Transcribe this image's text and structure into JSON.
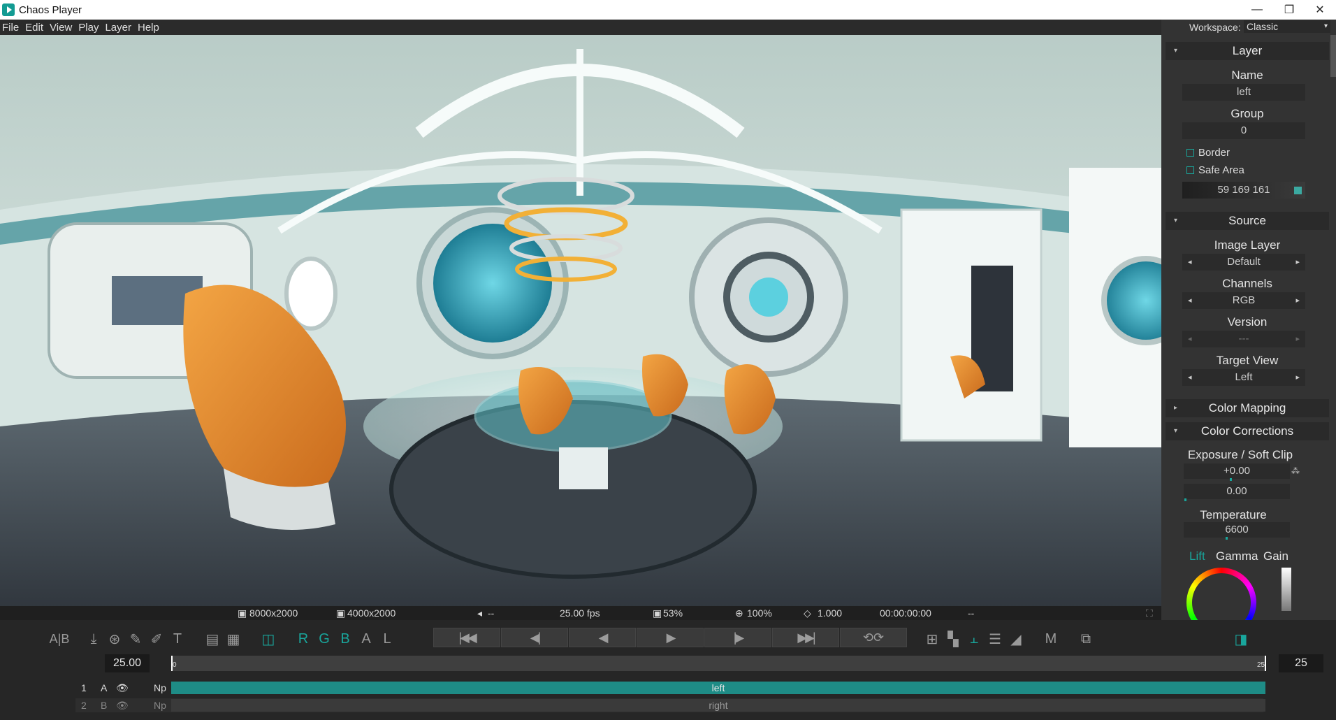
{
  "window": {
    "title": "Chaos Player",
    "minimize": "—",
    "restore": "❐",
    "close": "✕"
  },
  "menu": [
    "File",
    "Edit",
    "View",
    "Play",
    "Layer",
    "Help"
  ],
  "workspace": {
    "label": "Workspace:",
    "value": "Classic"
  },
  "info": {
    "resolution1": "8000x2000",
    "resolution2": "4000x2000",
    "audio": "--",
    "fps": "25.00 fps",
    "quality": "53%",
    "zoom": "100%",
    "aspect": "1.000",
    "timecode": "00:00:00:00",
    "extra": "--"
  },
  "layer_panel": {
    "title": "Layer",
    "name_label": "Name",
    "name_value": "left",
    "group_label": "Group",
    "group_value": "0",
    "border_label": "Border",
    "safe_area_label": "Safe Area",
    "color_value": "59 169 161",
    "color_swatch": "#3ba9a1"
  },
  "source_panel": {
    "title": "Source",
    "image_layer_label": "Image Layer",
    "image_layer_value": "Default",
    "channels_label": "Channels",
    "channels_value": "RGB",
    "version_label": "Version",
    "version_value": "---",
    "target_view_label": "Target View",
    "target_view_value": "Left"
  },
  "color_mapping": {
    "title": "Color Mapping"
  },
  "color_corrections": {
    "title": "Color Corrections",
    "exposure_label": "Exposure / Soft Clip",
    "exposure_value": "+0.00",
    "softclip_value": "0.00",
    "temperature_label": "Temperature",
    "temperature_value": "6600",
    "tabs": [
      "Lift",
      "Gamma",
      "Gain"
    ],
    "active_tab": "Lift"
  },
  "toolbar": {
    "ab": "A|B",
    "channels": [
      "R",
      "G",
      "B",
      "A",
      "L"
    ],
    "m": "M"
  },
  "timeline": {
    "current_frame": "25.00",
    "start_tick": "0",
    "end_tick": "25",
    "end_frame": "25"
  },
  "tracks": [
    {
      "num": "1",
      "slot": "A",
      "np": "Np",
      "label": "left"
    },
    {
      "num": "2",
      "slot": "B",
      "np": "Np",
      "label": "right"
    }
  ],
  "colors": {
    "accent": "#19a69c",
    "track_active": "#1e8c86",
    "track_inactive": "#3a3a3a"
  }
}
